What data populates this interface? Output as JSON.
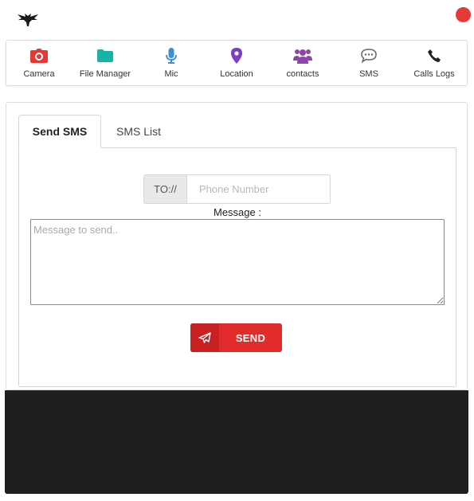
{
  "header": {
    "logo_icon": "bird-logo-icon",
    "status_color": "#e53935"
  },
  "nav": {
    "items": [
      {
        "label": "Camera",
        "icon": "camera-icon",
        "color": "#e53935"
      },
      {
        "label": "File Manager",
        "icon": "folder-icon",
        "color": "#17b3a6"
      },
      {
        "label": "Mic",
        "icon": "microphone-icon",
        "color": "#3a8fd6"
      },
      {
        "label": "Location",
        "icon": "location-pin-icon",
        "color": "#7b3fc4"
      },
      {
        "label": "contacts",
        "icon": "users-icon",
        "color": "#8e44ad"
      },
      {
        "label": "SMS",
        "icon": "chat-bubble-icon",
        "color": "#666666"
      },
      {
        "label": "Calls Logs",
        "icon": "phone-icon",
        "color": "#222222"
      }
    ]
  },
  "tabs": {
    "active": "Send SMS",
    "inactive": "SMS List"
  },
  "form": {
    "to_label": "TO://",
    "phone_placeholder": "Phone Number",
    "message_label": "Message :",
    "message_placeholder": "Message to send..",
    "send_label": "SEND",
    "send_icon": "paper-plane-icon",
    "accent_color": "#e22b2b"
  }
}
